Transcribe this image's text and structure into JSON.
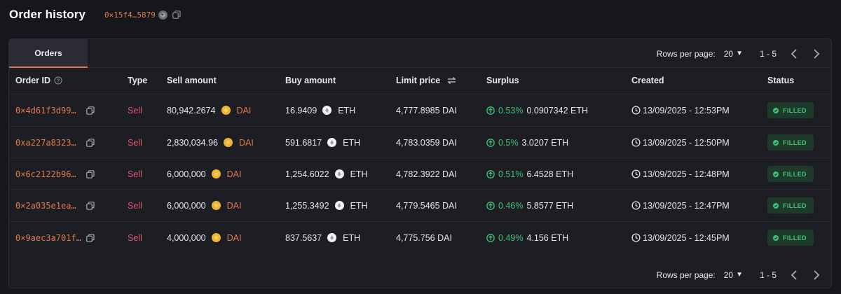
{
  "header": {
    "title": "Order history",
    "wallet_address": "0×15f4…5879",
    "icons": [
      "wallet-avatar-icon",
      "copy-icon"
    ]
  },
  "tabs": [
    {
      "label": "Orders",
      "active": true
    }
  ],
  "pagination": {
    "rows_label": "Rows per page:",
    "rows_value": "20",
    "range": "1 - 5"
  },
  "columns": {
    "order_id": "Order ID",
    "type": "Type",
    "sell_amount": "Sell amount",
    "buy_amount": "Buy amount",
    "limit_price": "Limit price",
    "surplus": "Surplus",
    "created": "Created",
    "status": "Status"
  },
  "orders": [
    {
      "id": "0×4d61f3d99…",
      "type": "Sell",
      "sell_amount": "80,942.2674",
      "sell_token": "DAI",
      "buy_amount": "16.9409",
      "buy_token": "ETH",
      "limit_price": "4,777.8985 DAI",
      "surplus_pct": "0.53%",
      "surplus_value": "0.0907342 ETH",
      "created": "13/09/2025 - 12:53PM",
      "status": "FILLED"
    },
    {
      "id": "0xa227a8323…",
      "type": "Sell",
      "sell_amount": "2,830,034.96",
      "sell_token": "DAI",
      "buy_amount": "591.6817",
      "buy_token": "ETH",
      "limit_price": "4,783.0359 DAI",
      "surplus_pct": "0.5%",
      "surplus_value": "3.0207 ETH",
      "created": "13/09/2025 - 12:50PM",
      "status": "FILLED"
    },
    {
      "id": "0×6c2122b96…",
      "type": "Sell",
      "sell_amount": "6,000,000",
      "sell_token": "DAI",
      "buy_amount": "1,254.6022",
      "buy_token": "ETH",
      "limit_price": "4,782.3922 DAI",
      "surplus_pct": "0.51%",
      "surplus_value": "6.4528 ETH",
      "created": "13/09/2025 - 12:48PM",
      "status": "FILLED"
    },
    {
      "id": "0×2a035e1ea…",
      "type": "Sell",
      "sell_amount": "6,000,000",
      "sell_token": "DAI",
      "buy_amount": "1,255.3492",
      "buy_token": "ETH",
      "limit_price": "4,779.5465 DAI",
      "surplus_pct": "0.46%",
      "surplus_value": "5.8577 ETH",
      "created": "13/09/2025 - 12:47PM",
      "status": "FILLED"
    },
    {
      "id": "0×9aec3a701f…",
      "type": "Sell",
      "sell_amount": "4,000,000",
      "sell_token": "DAI",
      "buy_amount": "837.5637",
      "buy_token": "ETH",
      "limit_price": "4,775.756 DAI",
      "surplus_pct": "0.49%",
      "surplus_value": "4.156 ETH",
      "created": "13/09/2025 - 12:45PM",
      "status": "FILLED"
    }
  ],
  "colors": {
    "background": "#16171d",
    "panel": "#1d1e24",
    "accent": "#e0794d",
    "sell": "#e0556c",
    "positive": "#3ec27a",
    "badge_bg": "#1f3a2b"
  }
}
